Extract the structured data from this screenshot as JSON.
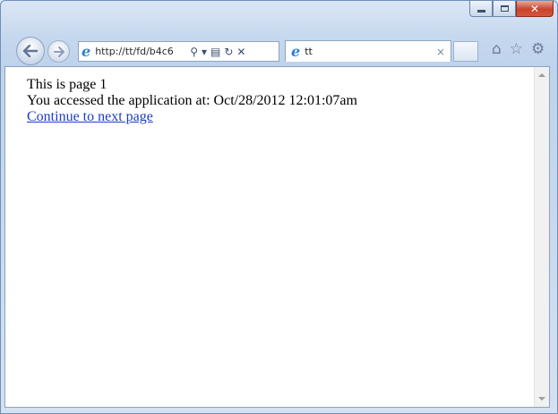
{
  "window": {
    "caption_buttons": [
      "minimize",
      "maximize",
      "close"
    ]
  },
  "toolbar": {
    "back_icon": "back-arrow-icon",
    "forward_icon": "forward-arrow-icon",
    "address_url": "http://tt/fd/b4c6",
    "address_icons": [
      "search-icon",
      "dropdown-arrow-icon",
      "compatibility-view-icon",
      "refresh-icon",
      "stop-icon"
    ]
  },
  "tab": {
    "title": "tt",
    "close_label": "×"
  },
  "right_icons": [
    "home-icon",
    "favorites-star-icon",
    "tools-gear-icon"
  ],
  "page": {
    "line1": "This is page 1",
    "line2": "You accessed the application at: Oct/28/2012 12:01:07am",
    "link": "Continue to next page"
  },
  "colors": {
    "link": "#1a3cc6",
    "close_button": "#c8452d",
    "ie_icon": "#2f7ed8"
  }
}
